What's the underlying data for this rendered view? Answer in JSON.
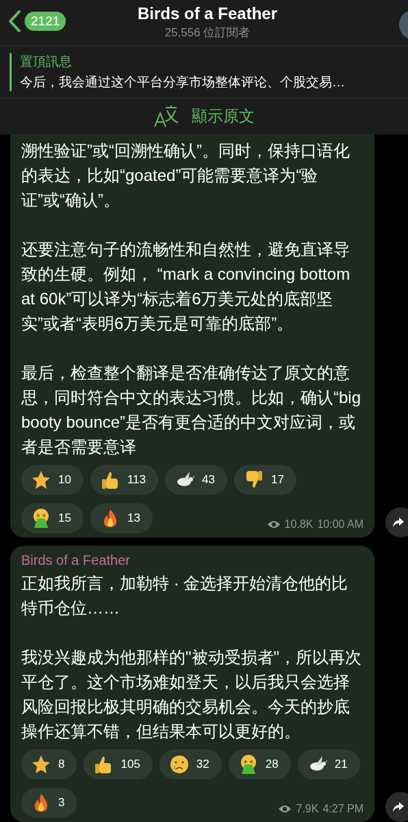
{
  "header": {
    "back_badge": "2121",
    "title": "Birds of a Feather",
    "subtitle": "25,556 位訂閱者"
  },
  "pinned": {
    "label": "置頂訊息",
    "text": "今后，我会通过这个平台分享市场整体评论、个股交易…"
  },
  "translate": {
    "label": "顯示原文"
  },
  "messages": [
    {
      "paragraphs": [
        "溯性验证”或“回溯性确认”。同时，保持口语化的表达，比如“goated”可能需要意译为“验证”或“确认”。",
        "还要注意句子的流畅性和自然性，避免直译导致的生硬。例如， “mark a convincing bottom at 60k”可以译为“标志着6万美元处的底部坚实”或者“表明6万美元是可靠的底部”。",
        "最后，检查整个翻译是否准确传达了原文的意思，同时符合中文的表达习惯。比如，确认“big booty bounce”是否有更合适的中文对应词，或者是否需要意译"
      ],
      "reactions": [
        {
          "kind": "star",
          "count": "10"
        },
        {
          "kind": "thumbs-up",
          "count": "113"
        },
        {
          "kind": "dove",
          "count": "43"
        },
        {
          "kind": "thumbs-down",
          "count": "17"
        },
        {
          "kind": "vomit",
          "count": "15"
        },
        {
          "kind": "fire",
          "count": "13"
        }
      ],
      "views": "10.8K",
      "time": "10:00 AM"
    },
    {
      "sender": "Birds of a Feather",
      "paragraphs": [
        "正如我所言，加勒特 · 金选择开始清仓他的比特币仓位……",
        "我没兴趣成为他那样的\"被动受损者\"，所以再次平仓了。这个市场难如登天，以后我只会选择风险回报比极其明确的交易机会。今天的抄底操作还算不错，但结果本可以更好的。"
      ],
      "reactions": [
        {
          "kind": "star",
          "count": "8"
        },
        {
          "kind": "thumbs-up",
          "count": "105"
        },
        {
          "kind": "crying",
          "count": "32"
        },
        {
          "kind": "vomit",
          "count": "28"
        },
        {
          "kind": "dove",
          "count": "21"
        },
        {
          "kind": "fire",
          "count": "3"
        }
      ],
      "views": "7.9K",
      "time": "4:27 PM"
    }
  ]
}
